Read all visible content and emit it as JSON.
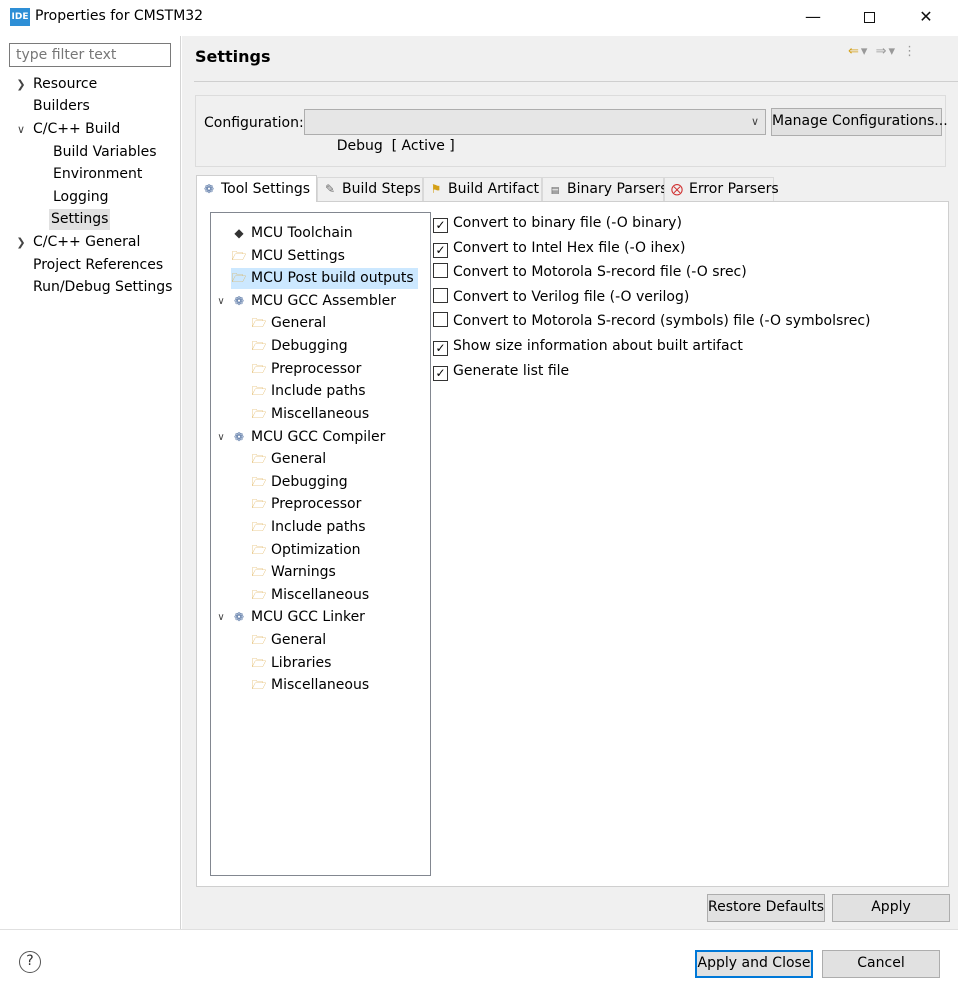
{
  "window": {
    "app_icon": "IDE",
    "title": "Properties for CMSTM32",
    "minimize_icon": "minimize-icon",
    "maximize_icon": "maximize-icon",
    "close_icon": "close-icon"
  },
  "filter": {
    "placeholder": "type filter text"
  },
  "sidebar": {
    "items": [
      {
        "label": "Resource",
        "expander": "collapsed"
      },
      {
        "label": "Builders"
      },
      {
        "label": "C/C++ Build",
        "expander": "expanded"
      },
      {
        "label": "Build Variables"
      },
      {
        "label": "Environment"
      },
      {
        "label": "Logging"
      },
      {
        "label": "Settings",
        "selected": true
      },
      {
        "label": "C/C++ General",
        "expander": "collapsed"
      },
      {
        "label": "Project References"
      },
      {
        "label": "Run/Debug Settings"
      }
    ]
  },
  "page": {
    "title": "Settings"
  },
  "configuration": {
    "label": "Configuration:",
    "value": "Debug  [ Active ]",
    "manage_label": "Manage Configurations..."
  },
  "tabs": [
    {
      "label": "Tool Settings",
      "icon": "tool-settings-icon",
      "active": true
    },
    {
      "label": "Build Steps",
      "icon": "build-steps-icon"
    },
    {
      "label": "Build Artifact",
      "icon": "build-artifact-icon"
    },
    {
      "label": "Binary Parsers",
      "icon": "binary-parsers-icon"
    },
    {
      "label": "Error Parsers",
      "icon": "error-parsers-icon"
    }
  ],
  "tree": {
    "items": [
      {
        "label": "MCU Toolchain",
        "icon": "toolchain-icon"
      },
      {
        "label": "MCU Settings",
        "icon": "folder-icon"
      },
      {
        "label": "MCU Post build outputs",
        "icon": "folder-icon",
        "selected": true
      },
      {
        "label": "MCU GCC Assembler",
        "icon": "tool-icon",
        "expander": "expanded"
      },
      {
        "label": "General",
        "icon": "folder-icon"
      },
      {
        "label": "Debugging",
        "icon": "folder-icon"
      },
      {
        "label": "Preprocessor",
        "icon": "folder-icon"
      },
      {
        "label": "Include paths",
        "icon": "folder-icon"
      },
      {
        "label": "Miscellaneous",
        "icon": "folder-icon"
      },
      {
        "label": "MCU GCC Compiler",
        "icon": "tool-icon",
        "expander": "expanded"
      },
      {
        "label": "General",
        "icon": "folder-icon"
      },
      {
        "label": "Debugging",
        "icon": "folder-icon"
      },
      {
        "label": "Preprocessor",
        "icon": "folder-icon"
      },
      {
        "label": "Include paths",
        "icon": "folder-icon"
      },
      {
        "label": "Optimization",
        "icon": "folder-icon"
      },
      {
        "label": "Warnings",
        "icon": "folder-icon"
      },
      {
        "label": "Miscellaneous",
        "icon": "folder-icon"
      },
      {
        "label": "MCU GCC Linker",
        "icon": "tool-icon",
        "expander": "expanded"
      },
      {
        "label": "General",
        "icon": "folder-icon"
      },
      {
        "label": "Libraries",
        "icon": "folder-icon"
      },
      {
        "label": "Miscellaneous",
        "icon": "folder-icon"
      }
    ]
  },
  "options": [
    {
      "label": "Convert to binary file (-O binary)",
      "checked": true
    },
    {
      "label": "Convert to Intel Hex file (-O ihex)",
      "checked": true
    },
    {
      "label": "Convert to Motorola S-record file (-O srec)",
      "checked": false
    },
    {
      "label": "Convert to Verilog file (-O verilog)",
      "checked": false
    },
    {
      "label": "Convert to Motorola S-record (symbols) file (-O symbolsrec)",
      "checked": false
    },
    {
      "label": "Show size information about built artifact",
      "checked": true
    },
    {
      "label": "Generate list file",
      "checked": true
    }
  ],
  "buttons": {
    "restore_defaults": "Restore Defaults",
    "apply": "Apply",
    "apply_and_close": "Apply and Close",
    "cancel": "Cancel",
    "help": "?"
  },
  "colors": {
    "accent": "#0078d7",
    "selection": "#cce8ff",
    "folder": "#d9a43a"
  }
}
